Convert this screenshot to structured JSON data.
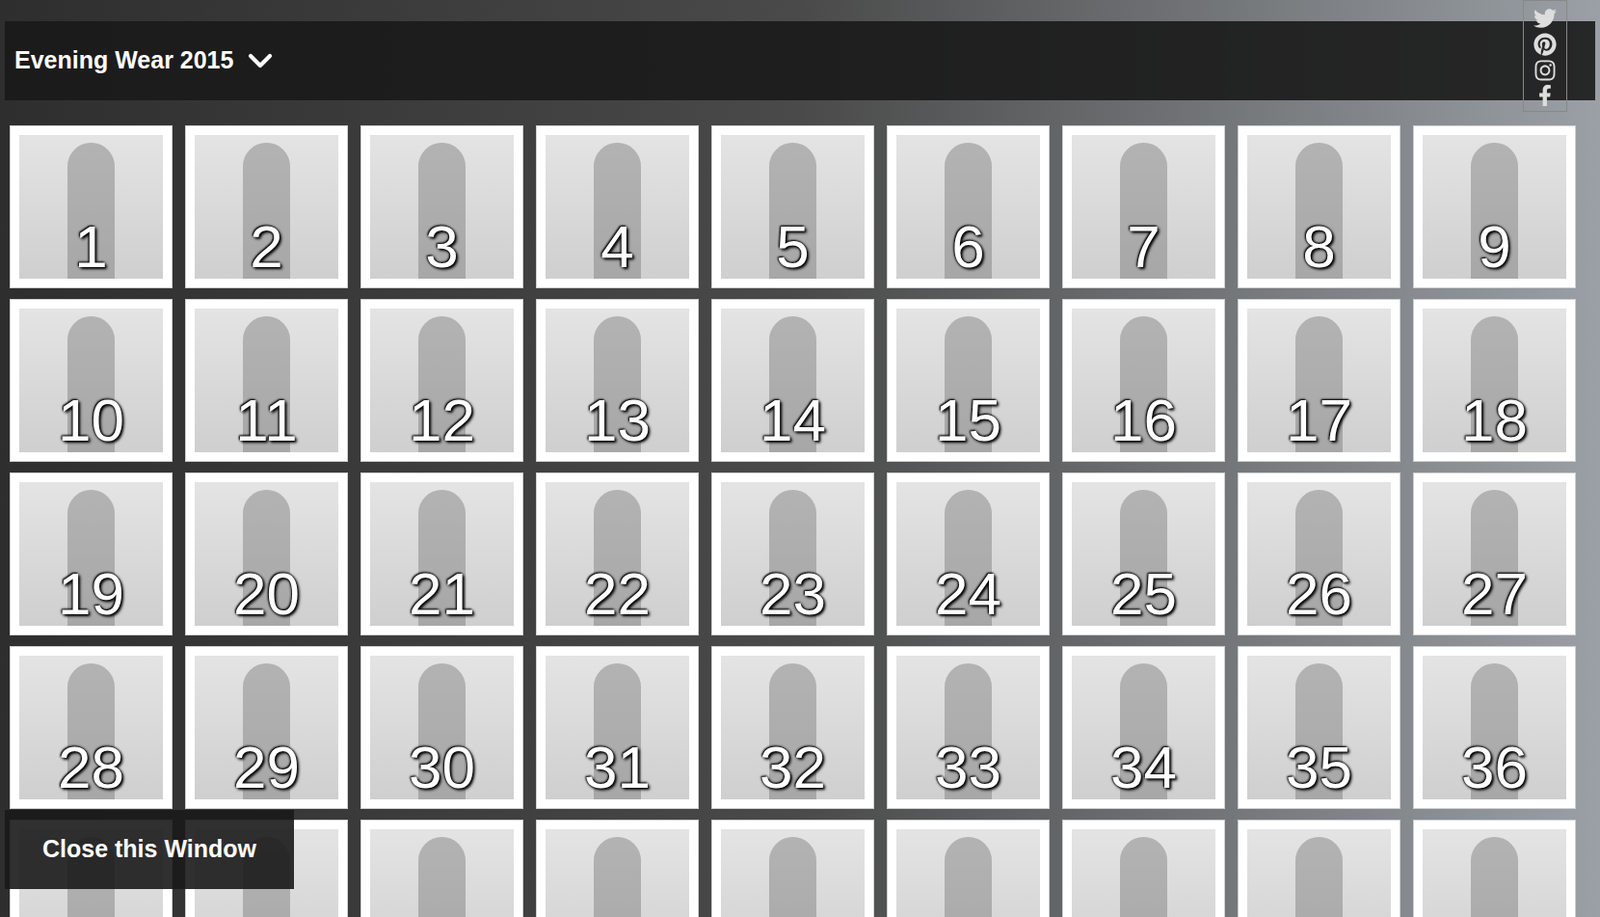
{
  "header": {
    "title": "Evening Wear 2015"
  },
  "gallery": {
    "items": [
      {
        "number": "1"
      },
      {
        "number": "2"
      },
      {
        "number": "3"
      },
      {
        "number": "4"
      },
      {
        "number": "5"
      },
      {
        "number": "6"
      },
      {
        "number": "7"
      },
      {
        "number": "8"
      },
      {
        "number": "9"
      },
      {
        "number": "10"
      },
      {
        "number": "11"
      },
      {
        "number": "12"
      },
      {
        "number": "13"
      },
      {
        "number": "14"
      },
      {
        "number": "15"
      },
      {
        "number": "16"
      },
      {
        "number": "17"
      },
      {
        "number": "18"
      },
      {
        "number": "19"
      },
      {
        "number": "20"
      },
      {
        "number": "21"
      },
      {
        "number": "22"
      },
      {
        "number": "23"
      },
      {
        "number": "24"
      },
      {
        "number": "25"
      },
      {
        "number": "26"
      },
      {
        "number": "27"
      },
      {
        "number": "28"
      },
      {
        "number": "29"
      },
      {
        "number": "30"
      },
      {
        "number": "31"
      },
      {
        "number": "32"
      },
      {
        "number": "33"
      },
      {
        "number": "34"
      },
      {
        "number": "35"
      },
      {
        "number": "36"
      },
      {
        "number": ""
      },
      {
        "number": ""
      },
      {
        "number": ""
      },
      {
        "number": ""
      },
      {
        "number": ""
      },
      {
        "number": ""
      },
      {
        "number": ""
      },
      {
        "number": ""
      },
      {
        "number": ""
      }
    ]
  },
  "close_button": {
    "label": "Close this Window"
  }
}
